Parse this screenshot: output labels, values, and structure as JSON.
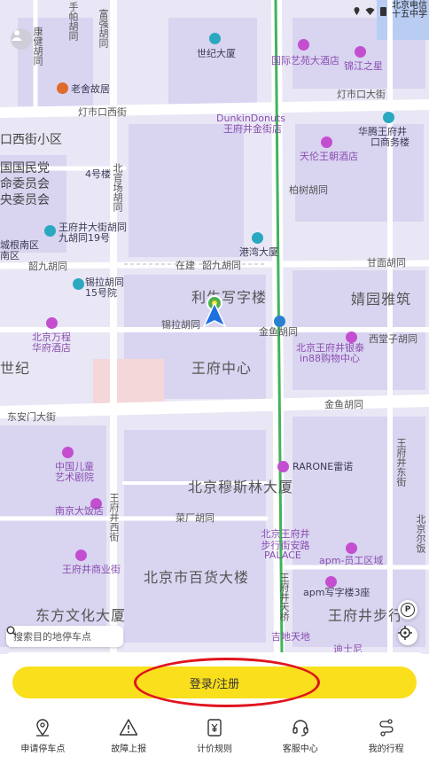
{
  "status_bar": {
    "carrier_top": "北京电信",
    "carrier_bottom": "十五中学"
  },
  "map": {
    "labels": {
      "kangjian": "康健胡同",
      "shoudi": "手帕胡同",
      "fuqiang": "富强胡同",
      "shijidasha": "世纪大厦",
      "guojiyiyuan": "国际艺苑大酒店",
      "jinzhixing": "锦江之星",
      "laohejiu": "老舍故居",
      "dengshikoushi_w": "灯市口西街",
      "dengshikoushi_e": "灯市口大街",
      "dunkin": "DunkinDonuts",
      "dunkin_sub": "王府井金街店",
      "huateng": "华腾王府井",
      "huateng2": "口商务楼",
      "dengshixiaoqu": "口西街小区",
      "guominzheng1": "国国民党",
      "guominzheng2": "命委员会",
      "guominzheng3": "央委员会",
      "silou": "4号楼",
      "beiguanchang": "北官场胡同",
      "tianlun": "天伦王朝酒店",
      "baishu": "柏树胡同",
      "wangfujing_jiu": "王府井大街胡同",
      "wangfujing_jiu2": "九胡同19号",
      "gangwan": "港湾大厦",
      "weixin": "城根南区",
      "weixin2": "南区",
      "jiuer": "韶九胡同",
      "zaijian": "在建",
      "jiuer2": "韶九胡同",
      "ganmian": "甘面胡同",
      "xila15": "锡拉胡同",
      "xila15b": "15号院",
      "lisheng": "利生写字楼",
      "jingyuan": "婧园雅筑",
      "xila": "锡拉胡同",
      "jinyu": "金鱼胡同",
      "beijingwanfang": "北京万程",
      "beijingwanfang2": "华府酒店",
      "beijingyinjie": "北京王府井银泰",
      "beijingyinjie2": "in88购物中心",
      "xitangzi": "西堂子胡同",
      "shiji": "世纪",
      "wangfuzhongxin": "王府中心",
      "dongan": "东安门大街",
      "jinyu2": "金鱼胡同",
      "ertong": "中国儿童",
      "ertong2": "艺术剧院",
      "rarone": "RARONE雷诺",
      "wangfujingdong": "王府井东街",
      "musilin": "北京穆斯林大厦",
      "nanjing": "南京大饭店",
      "caichang": "菜厂胡同",
      "wangfujingxi": "王府井西街",
      "buxingjie": "北京王府井步行街安路",
      "palace": "PALACE",
      "apm": "apm-员工区域",
      "shangyejie": "王府井商业街",
      "baihuo": "北京市百货大楼",
      "apm3": "apm写字楼3座",
      "dongfang": "东方文化大厦",
      "buxing": "王府井步行",
      "jishi": "吉地天地",
      "dishini": "迪士尼",
      "wangfutai": "王府井天桥",
      "beijing_er": "北京尔饭"
    }
  },
  "search": {
    "placeholder": "搜索目的地停车点"
  },
  "login_button": "登录/注册",
  "tabs": [
    {
      "label": "申请停车点",
      "icon": "location-pin-plus-icon"
    },
    {
      "label": "故障上报",
      "icon": "warning-triangle-icon"
    },
    {
      "label": "计价规则",
      "icon": "yuan-receipt-icon"
    },
    {
      "label": "客服中心",
      "icon": "headset-icon"
    },
    {
      "label": "我的行程",
      "icon": "route-icon"
    }
  ],
  "colors": {
    "accent": "#f9df1c",
    "highlight_ring": "#e0141e",
    "map_bg": "#e9e7f5"
  }
}
